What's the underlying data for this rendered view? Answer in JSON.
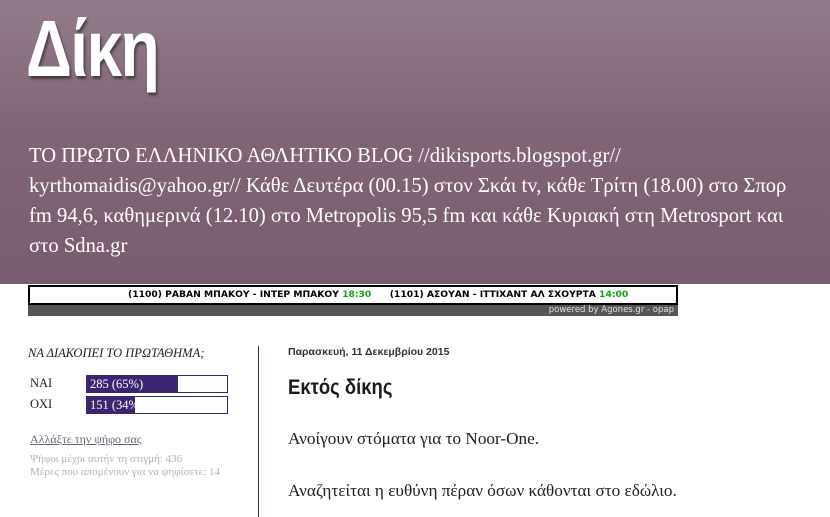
{
  "header": {
    "title": "Δίκη",
    "description": "ΤΟ ΠΡΩΤΟ ΕΛΛΗΝΙΚΟ ΑΘΛΗΤΙΚΟ BLOG //dikisports.blogspot.gr// kyrthomaidis@yahoo.gr// Κάθε Δευτέρα (00.15) στον Σκάι tv, κάθε Τρίτη (18.00) στο Σπορ fm 94,6, καθημερινά (12.10) στο Metropolis 95,5 fm και κάθε Κυριακή στη Metrosport και στο Sdna.gr"
  },
  "ticker": {
    "match1": {
      "code": "(1100)",
      "teams": "ΡΑΒΑΝ ΜΠΑΚΟΥ - ΙΝΤΕΡ ΜΠΑΚΟΥ",
      "time": "18:30"
    },
    "match2": {
      "code": "(1101)",
      "teams": "ΑΣΟΥΑΝ - ΙΤΤΙΧΑΝΤ ΑΛ ΣΧΟΥΡΤΑ",
      "time": "14:00"
    },
    "powered_by": "powered by Agones.gr - opap"
  },
  "poll": {
    "question": "ΝΑ ΔΙΑΚΟΠΕΙ ΤΟ ΠΡΩΤΑΘΗΜΑ;",
    "options": [
      {
        "label": "ΝΑΙ",
        "value_text": "285 (65%)",
        "fraction": 0.65
      },
      {
        "label": "ΟΧΙ",
        "value_text": "151 (34%)",
        "fraction": 0.34
      }
    ],
    "change_vote": "Αλλάξτε την ψήφο σας",
    "votes_so_far": "Ψήφοι μέχρι αυτήν τη στιγμή: 436",
    "days_left": "Μέρες που απομένουν για να ψηφίσετε: 14",
    "bar_color": "#3b2472"
  },
  "post": {
    "date": "Παρασκευή, 11 Δεκεμβρίου 2015",
    "title": "Εκτός δίκης",
    "paragraphs": [
      "Ανοίγουν στόματα για το Noor-One.",
      "Αναζητείται η ευθύνη πέραν όσων κάθονται στο εδώλιο."
    ]
  }
}
